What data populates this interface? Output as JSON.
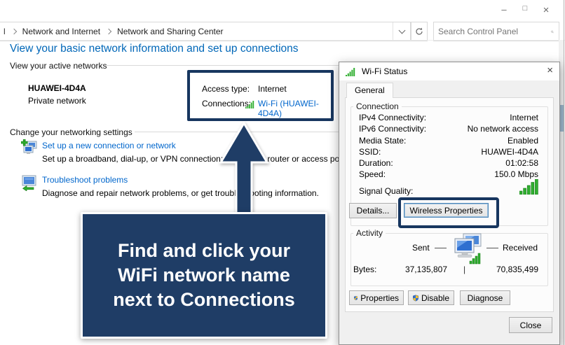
{
  "window": {
    "controls": {
      "minimize": "–",
      "maximize": "□",
      "close": "×"
    },
    "breadcrumb": {
      "fragment": "l",
      "items": [
        "Network and Internet",
        "Network and Sharing Center"
      ]
    },
    "search": {
      "placeholder": "Search Control Panel"
    }
  },
  "main": {
    "heading": "View your basic network information and set up connections",
    "active_networks": {
      "section_label": "View your active networks",
      "network_name": "HUAWEI-4D4A",
      "network_type": "Private network",
      "access_type_label": "Access type:",
      "access_type_value": "Internet",
      "connections_label": "Connections:",
      "connections_value": "Wi-Fi (HUAWEI-4D4A)"
    },
    "settings": {
      "section_label": "Change your networking settings",
      "items": [
        {
          "label": "Set up a new connection or network",
          "description": "Set up a broadband, dial-up, or VPN connection; or set up a router or access point."
        },
        {
          "label": "Troubleshoot problems",
          "description": "Diagnose and repair network problems, or get troubleshooting information."
        }
      ]
    }
  },
  "annotation": {
    "lines": [
      "Find and click your",
      "WiFi network name",
      "next to Connections"
    ]
  },
  "dialog": {
    "title": "Wi-Fi Status",
    "close_glyph": "×",
    "tab": "General",
    "connection": {
      "section_label": "Connection",
      "rows": [
        {
          "label": "IPv4 Connectivity:",
          "value": "Internet"
        },
        {
          "label": "IPv6 Connectivity:",
          "value": "No network access"
        },
        {
          "label": "Media State:",
          "value": "Enabled"
        },
        {
          "label": "SSID:",
          "value": "HUAWEI-4D4A"
        },
        {
          "label": "Duration:",
          "value": "01:02:58"
        },
        {
          "label": "Speed:",
          "value": "150.0 Mbps"
        }
      ],
      "signal_label": "Signal Quality:",
      "details_button": "Details...",
      "wireless_properties_button": "Wireless Properties"
    },
    "activity": {
      "section_label": "Activity",
      "sent_label": "Sent",
      "received_label": "Received",
      "bytes_label": "Bytes:",
      "sent_value": "37,135,807",
      "separator": "|",
      "received_value": "70,835,499"
    },
    "buttons": {
      "properties": "Properties",
      "disable": "Disable",
      "diagnose": "Diagnose",
      "close": "Close"
    }
  },
  "colors": {
    "link": "#0066cc",
    "heading": "#0067b8",
    "highlight_navy": "#17365f",
    "annotation_navy": "#1f3d66",
    "signal_green": "#2fae2f"
  }
}
